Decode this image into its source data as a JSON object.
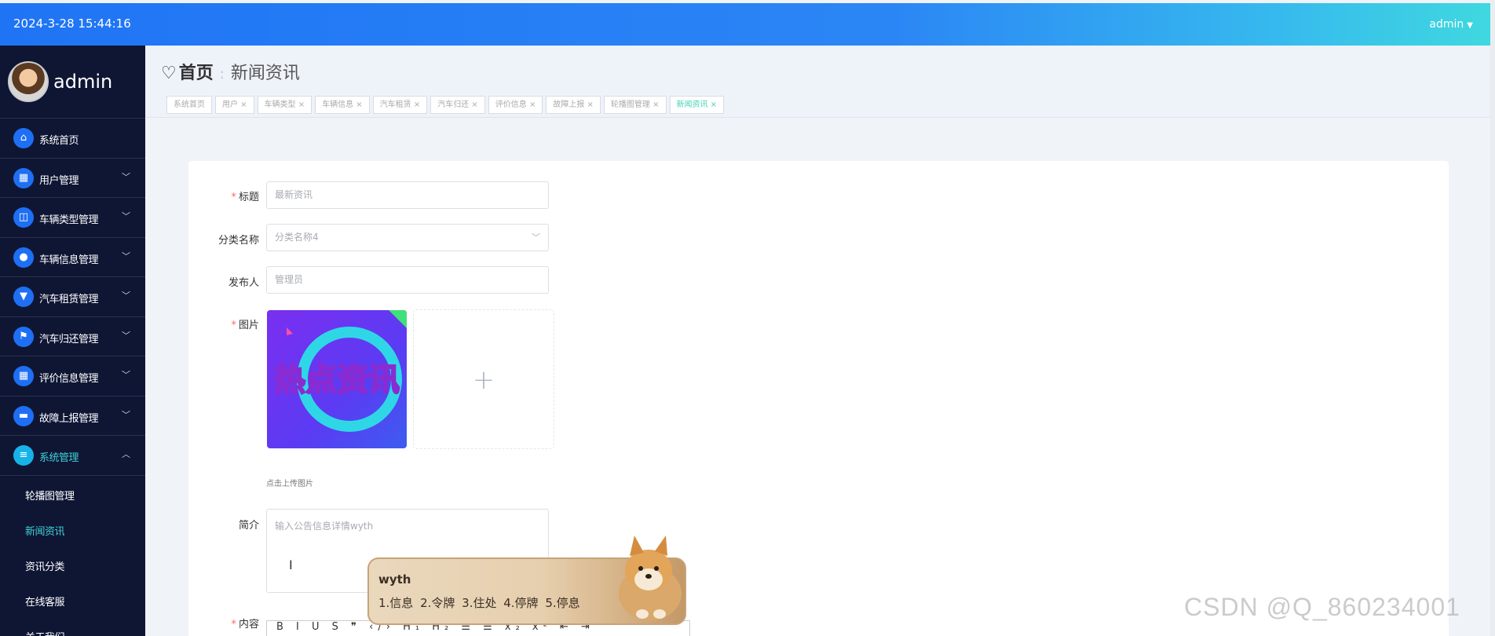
{
  "header": {
    "datetime": "2024-3-28 15:44:16",
    "user": "admin"
  },
  "sidebar": {
    "profile_name": "admin",
    "items": [
      {
        "label": "系统首页",
        "icon": "home-icon",
        "glyph": "⌂"
      },
      {
        "label": "用户管理",
        "icon": "grid-icon",
        "glyph": "▦"
      },
      {
        "label": "车辆类型管理",
        "icon": "chart-icon",
        "glyph": "◫"
      },
      {
        "label": "车辆信息管理",
        "icon": "location-icon",
        "glyph": "●"
      },
      {
        "label": "汽车租赁管理",
        "icon": "cup-icon",
        "glyph": "▼"
      },
      {
        "label": "汽车归还管理",
        "icon": "flag-icon",
        "glyph": "⚑"
      },
      {
        "label": "评价信息管理",
        "icon": "grid-icon",
        "glyph": "▦"
      },
      {
        "label": "故障上报管理",
        "icon": "briefcase-icon",
        "glyph": "▬"
      },
      {
        "label": "系统管理",
        "icon": "document-icon",
        "glyph": "≡"
      }
    ],
    "sub_items": [
      "轮播图管理",
      "新闻资讯",
      "资讯分类",
      "在线客服",
      "关于我们"
    ]
  },
  "breadcrumb": {
    "home": "首页",
    "current": "新闻资讯"
  },
  "tabs": [
    "系统首页",
    "用户 ×",
    "车辆类型 ×",
    "车辆信息 ×",
    "汽车租赁 ×",
    "汽车归还 ×",
    "评价信息 ×",
    "故障上报 ×",
    "轮播图管理 ×",
    "新闻资讯 ×"
  ],
  "form": {
    "title_label": "标题",
    "title_placeholder": "最新资讯",
    "category_label": "分类名称",
    "category_value": "分类名称4",
    "publisher_label": "发布人",
    "publisher_value": "管理员",
    "image_label": "图片",
    "image_text": "热点资讯",
    "upload_hint": "点击上传图片",
    "intro_label": "简介",
    "intro_value": "输入公告信息详情wyth",
    "content_label": "内容",
    "editor_toolbar": "B I U S ❞ ‹/› H₁ H₂ ☰ ☰ x₂ x² ⇤ ⇥"
  },
  "ime": {
    "typed": "wyth",
    "candidates": "1.信息  2.令牌  3.住处  4.停牌  5.停息"
  },
  "watermark": "CSDN @Q_860234001"
}
